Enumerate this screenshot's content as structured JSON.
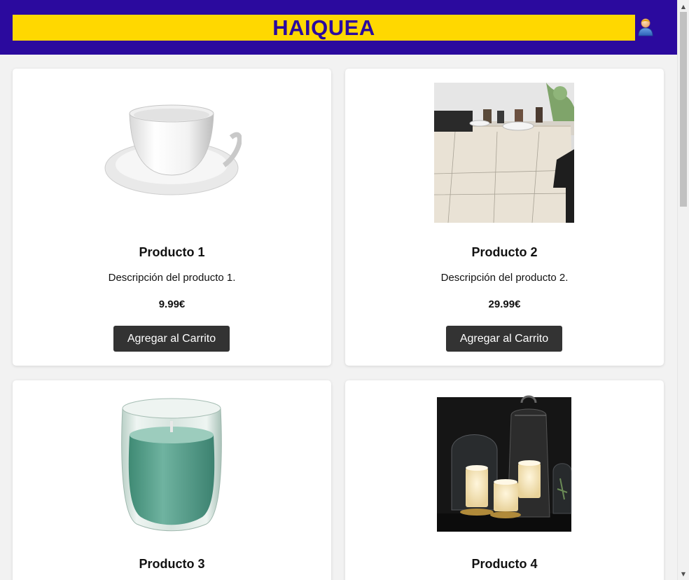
{
  "header": {
    "brand": "HAIQUEA",
    "user_icon": "user-icon"
  },
  "colors": {
    "header_bg": "#2b0a9e",
    "brand_bar": "#ffd800",
    "button_bg": "#333333",
    "page_bg": "#f2f2f2"
  },
  "products": [
    {
      "name": "Producto 1",
      "description": "Descripción del producto 1.",
      "price": "9.99€",
      "button": "Agregar al Carrito",
      "image": "teacup-saucer-image"
    },
    {
      "name": "Producto 2",
      "description": "Descripción del producto 2.",
      "price": "29.99€",
      "button": "Agregar al Carrito",
      "image": "tablecloth-dining-image"
    },
    {
      "name": "Producto 3",
      "description": "",
      "price": "",
      "button": "",
      "image": "green-candle-jar-image"
    },
    {
      "name": "Producto 4",
      "description": "",
      "price": "",
      "button": "",
      "image": "lantern-candles-image"
    }
  ]
}
